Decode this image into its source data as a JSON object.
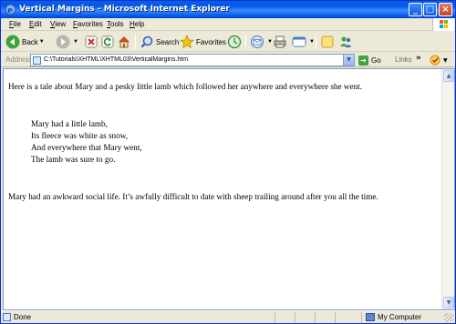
{
  "window": {
    "title": "Vertical Margins - Microsoft Internet Explorer"
  },
  "menu": {
    "items": [
      "File",
      "Edit",
      "View",
      "Favorites",
      "Tools",
      "Help"
    ]
  },
  "toolbar": {
    "back_label": "Back",
    "search_label": "Search",
    "favorites_label": "Favorites"
  },
  "address": {
    "label": "Address",
    "url": "C:\\Tutorials\\XHTML\\XHTML03\\VerticalMargins.htm",
    "go_label": "Go",
    "links_label": "Links",
    "links_chevron": "»"
  },
  "document": {
    "paragraph1": "Here is a tale about Mary and a pesky little lamb which followed her anywhere and everywhere she went.",
    "poem": [
      "Mary had a little lamb,",
      "Its fleece was white as snow,",
      "And everywhere that Mary went,",
      "The lamb was sure to go."
    ],
    "paragraph2": "Mary had an awkward social life. It’s awfully difficult to date with sheep trailing around after you all the time."
  },
  "status": {
    "text": "Done",
    "zone": "My Computer"
  },
  "colors": {
    "titlebar": "#0058EE",
    "chrome": "#ECE9D8",
    "content_bg": "#FFFFFF"
  }
}
